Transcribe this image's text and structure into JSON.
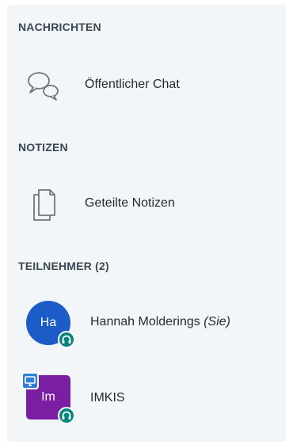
{
  "sections": {
    "messages": {
      "title": "NACHRICHTEN",
      "items": [
        {
          "label": "Öffentlicher Chat",
          "icon": "chat-bubbles-icon"
        }
      ]
    },
    "notes": {
      "title": "NOTIZEN",
      "items": [
        {
          "label": "Geteilte Notizen",
          "icon": "document-icon"
        }
      ]
    },
    "participants": {
      "title": "TEILNEHMER (2)",
      "users": [
        {
          "initials": "Ha",
          "name": "Hannah Molderings",
          "suffix": "(Sie)",
          "avatar_shape": "round",
          "avatar_color": "#1c5cc8",
          "audio": true,
          "presenter": false
        },
        {
          "initials": "Im",
          "name": "IMKIS",
          "suffix": "",
          "avatar_shape": "square",
          "avatar_color": "#7a1fa2",
          "audio": true,
          "presenter": true
        }
      ]
    }
  },
  "colors": {
    "panel_bg": "#f3f6f9",
    "audio_badge": "#00857a",
    "presenter_badge": "#2f7fd6"
  }
}
